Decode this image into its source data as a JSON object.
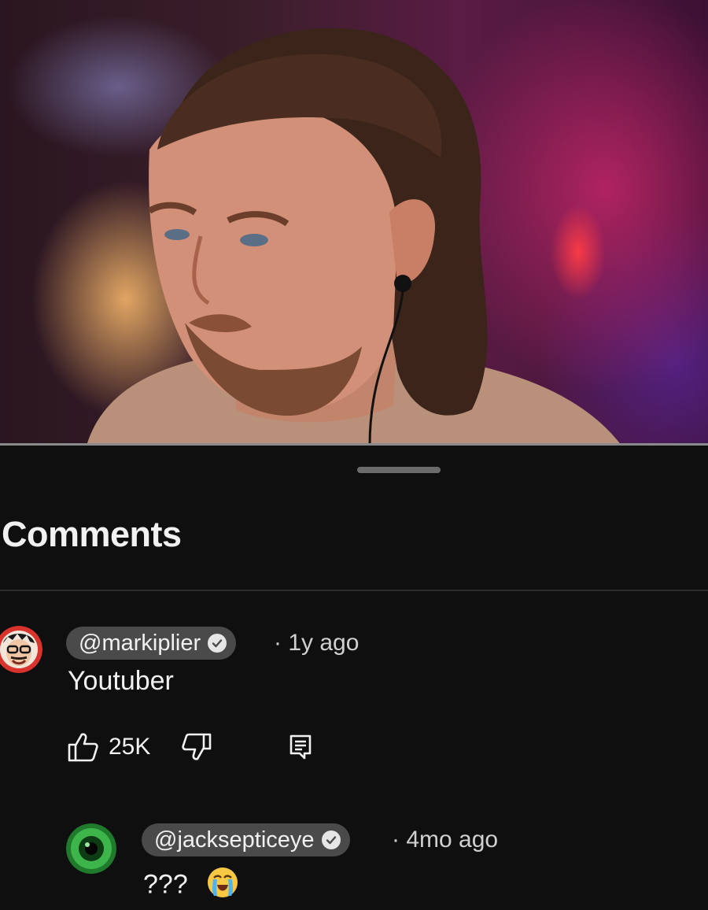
{
  "sheet": {
    "title": "Comments"
  },
  "video": {
    "description_icon": "video-frame"
  },
  "comments": [
    {
      "handle": "@markiplier",
      "verified": true,
      "time": "· 1y ago",
      "text": "Youtuber",
      "likes": "25K",
      "avatar_icon": "markiplier-avatar"
    }
  ],
  "reply": {
    "handle": "@jacksepticeye",
    "verified": true,
    "time": "· 4mo ago",
    "text": "???",
    "emoji": "loudly-crying-face",
    "avatar_icon": "jacksepticeye-avatar"
  },
  "colors": {
    "background": "#0f0f0f",
    "pill": "#4a4a4a",
    "text": "#f1f1f1",
    "meta": "#d0d0d0"
  }
}
